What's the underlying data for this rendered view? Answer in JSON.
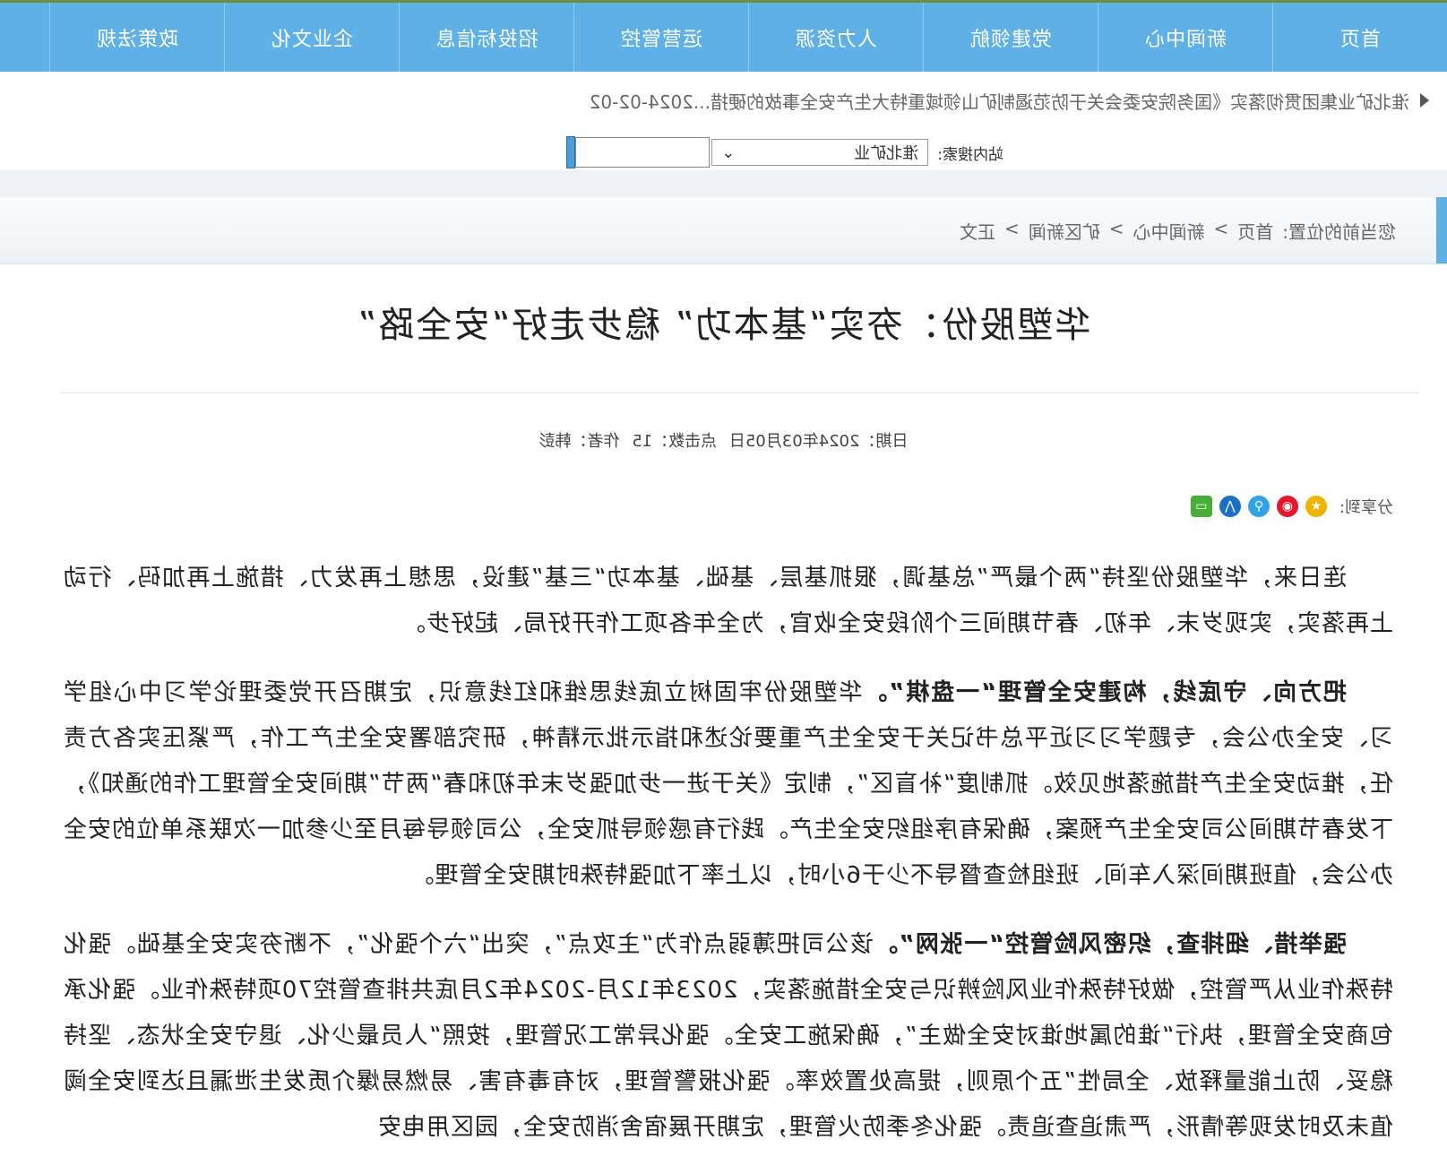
{
  "nav": {
    "items": [
      {
        "label": "首页"
      },
      {
        "label": "新闻中心"
      },
      {
        "label": "党建领航"
      },
      {
        "label": "人力资源"
      },
      {
        "label": "运营管控"
      },
      {
        "label": "招投标信息"
      },
      {
        "label": "企业文化"
      },
      {
        "label": "政策法规"
      }
    ]
  },
  "ticker": {
    "text": "淮北矿业集团贯彻落实《国务院安委会关于防范遏制矿山领域重特大生产安全事故的硬措...2024-02-02"
  },
  "search": {
    "label": "站内搜索:",
    "scope": "淮北矿业",
    "query": ""
  },
  "breadcrumb": {
    "prefix": "您当前的位置:",
    "items": [
      "首页",
      ">",
      "新闻中心",
      ">",
      "矿区新闻",
      ">",
      "正文"
    ]
  },
  "article": {
    "title": "华塑股份：夯实“基本功” 稳步走好“安全路”",
    "date": "日期：2024年03月05日",
    "views": "点击数：15",
    "author": "作者：韩彭",
    "share_label": "分享到:",
    "share_icons": [
      "star-icon",
      "weibo-icon",
      "qq-icon",
      "renren-icon",
      "wechat-icon"
    ],
    "p1": "连日来，华塑股份坚持“两个最严”总基调，狠抓基层、基础、基本功“三基”建设，思想上再发力、措施上再加码、行动上再落实，实现岁末、年初、春节期间三个阶段安全收官，为全年各项工作开好局、起好步。",
    "p2_bold": "把方向、守底线，构建安全管理“一盘棋”。",
    "p2": "华塑股份牢固树立底线思维和红线意识，定期召开党委理论学习中心组学习、安全办公会，专题学习习近平总书记关于安全生产重要论述和指示批示精神，研究部署安全生产工作，严紧压实各方责任，推动安全生产措施落地见效。抓制度“补盲区”，制定《关于进一步加强岁末年初和春“两节”期间安全管理工作的通知》，下发春节期间公司安全生产预案，确保有序组织安全生产。践行有感领导抓安全，公司领导每月至少参加一次联系单位的安全办公会，值班期间深入车间、班组检查督导不少于6小时，以上率下加强特殊时期安全管理。",
    "p3_bold": "强举措、细排查，织密风险管控“一张网”。",
    "p3": "该公司把薄弱点作为“主攻点”，突出“六个强化”，不断夯实安全基础。强化特殊作业从严管控，做好特殊作业风险辨识与安全措施落实，2023年12月-2024年2月底共排查管控70项特殊作业。强化承包商安全管理，执行“谁的属地谁对安全做主”，确保施工安全。强化异常工况管理，按照“人员最少化、退守安全状态、坚持稳妥、防止能量释放、全局性”五个原则，提高处置效率。强化报警管理，对有毒有害、易燃易爆介质发生泄漏且达到安全阈值未及时发现等情形，严肃追查追责。强化冬季防火管理，定期开展宿舍消防安全，园区用电安"
  }
}
